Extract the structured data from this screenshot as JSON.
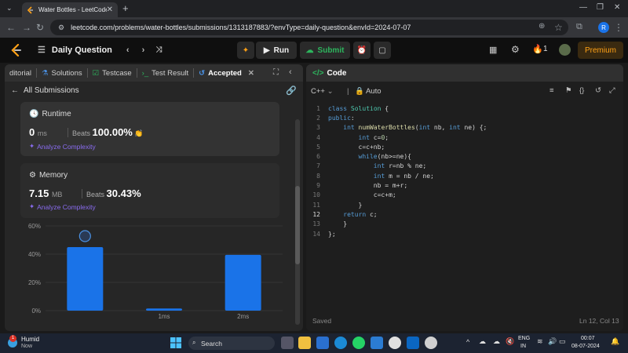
{
  "browser": {
    "tab_title": "Water Bottles - LeetCode",
    "url": "leetcode.com/problems/water-bottles/submissions/1313187883/?envType=daily-question&envId=2024-07-07"
  },
  "nav": {
    "daily_question": "Daily Question",
    "run_label": "Run",
    "submit_label": "Submit",
    "streak_count": "1",
    "premium_label": "Premium"
  },
  "left": {
    "tabs": {
      "editorial": "ditorial",
      "solutions": "Solutions",
      "testcase": "Testcase",
      "test_result": "Test Result",
      "accepted": "Accepted"
    },
    "all_submissions": "All Submissions",
    "runtime": {
      "heading": "Runtime",
      "value": "0",
      "unit": "ms",
      "beats_label": "Beats",
      "beats_value": "100.00%",
      "analyze": "Analyze Complexity"
    },
    "memory": {
      "heading": "Memory",
      "value": "7.15",
      "unit": "MB",
      "beats_label": "Beats",
      "beats_value": "30.43%",
      "analyze": "Analyze Complexity"
    }
  },
  "chart_data": {
    "type": "bar",
    "categories": [
      "",
      "1ms",
      "2ms"
    ],
    "values": [
      45,
      1.5,
      39.5
    ],
    "y_tick_labels": [
      "60%",
      "40%",
      "20%",
      "0%"
    ],
    "ylim": [
      0,
      60
    ],
    "bar_color": "#1a73e8"
  },
  "code": {
    "header": "Code",
    "language": "C++",
    "auto_label": "Auto",
    "lines": [
      {
        "n": "1",
        "text": "class Solution {"
      },
      {
        "n": "2",
        "text": "public:"
      },
      {
        "n": "3",
        "text": "    int numWaterBottles(int nb, int ne) {;"
      },
      {
        "n": "4",
        "text": "        int c=0;"
      },
      {
        "n": "5",
        "text": "        c=c+nb;"
      },
      {
        "n": "6",
        "text": "        while(nb>=ne){"
      },
      {
        "n": "7",
        "text": "            int r=nb % ne;"
      },
      {
        "n": "8",
        "text": "            int m = nb / ne;"
      },
      {
        "n": "9",
        "text": "            nb = m+r;"
      },
      {
        "n": "10",
        "text": "            c=c+m;"
      },
      {
        "n": "11",
        "text": "        }"
      },
      {
        "n": "12",
        "text": "    return c;"
      },
      {
        "n": "13",
        "text": "    }"
      },
      {
        "n": "14",
        "text": "};"
      }
    ],
    "saved": "Saved",
    "cursor_pos": "Ln 12, Col 13"
  },
  "taskbar": {
    "weather_label": "Humid",
    "weather_sub": "Now",
    "search_placeholder": "Search",
    "lang": "ENG",
    "lang_sub": "IN",
    "time": "00:07",
    "date": "08-07-2024",
    "notif_count": "1"
  }
}
